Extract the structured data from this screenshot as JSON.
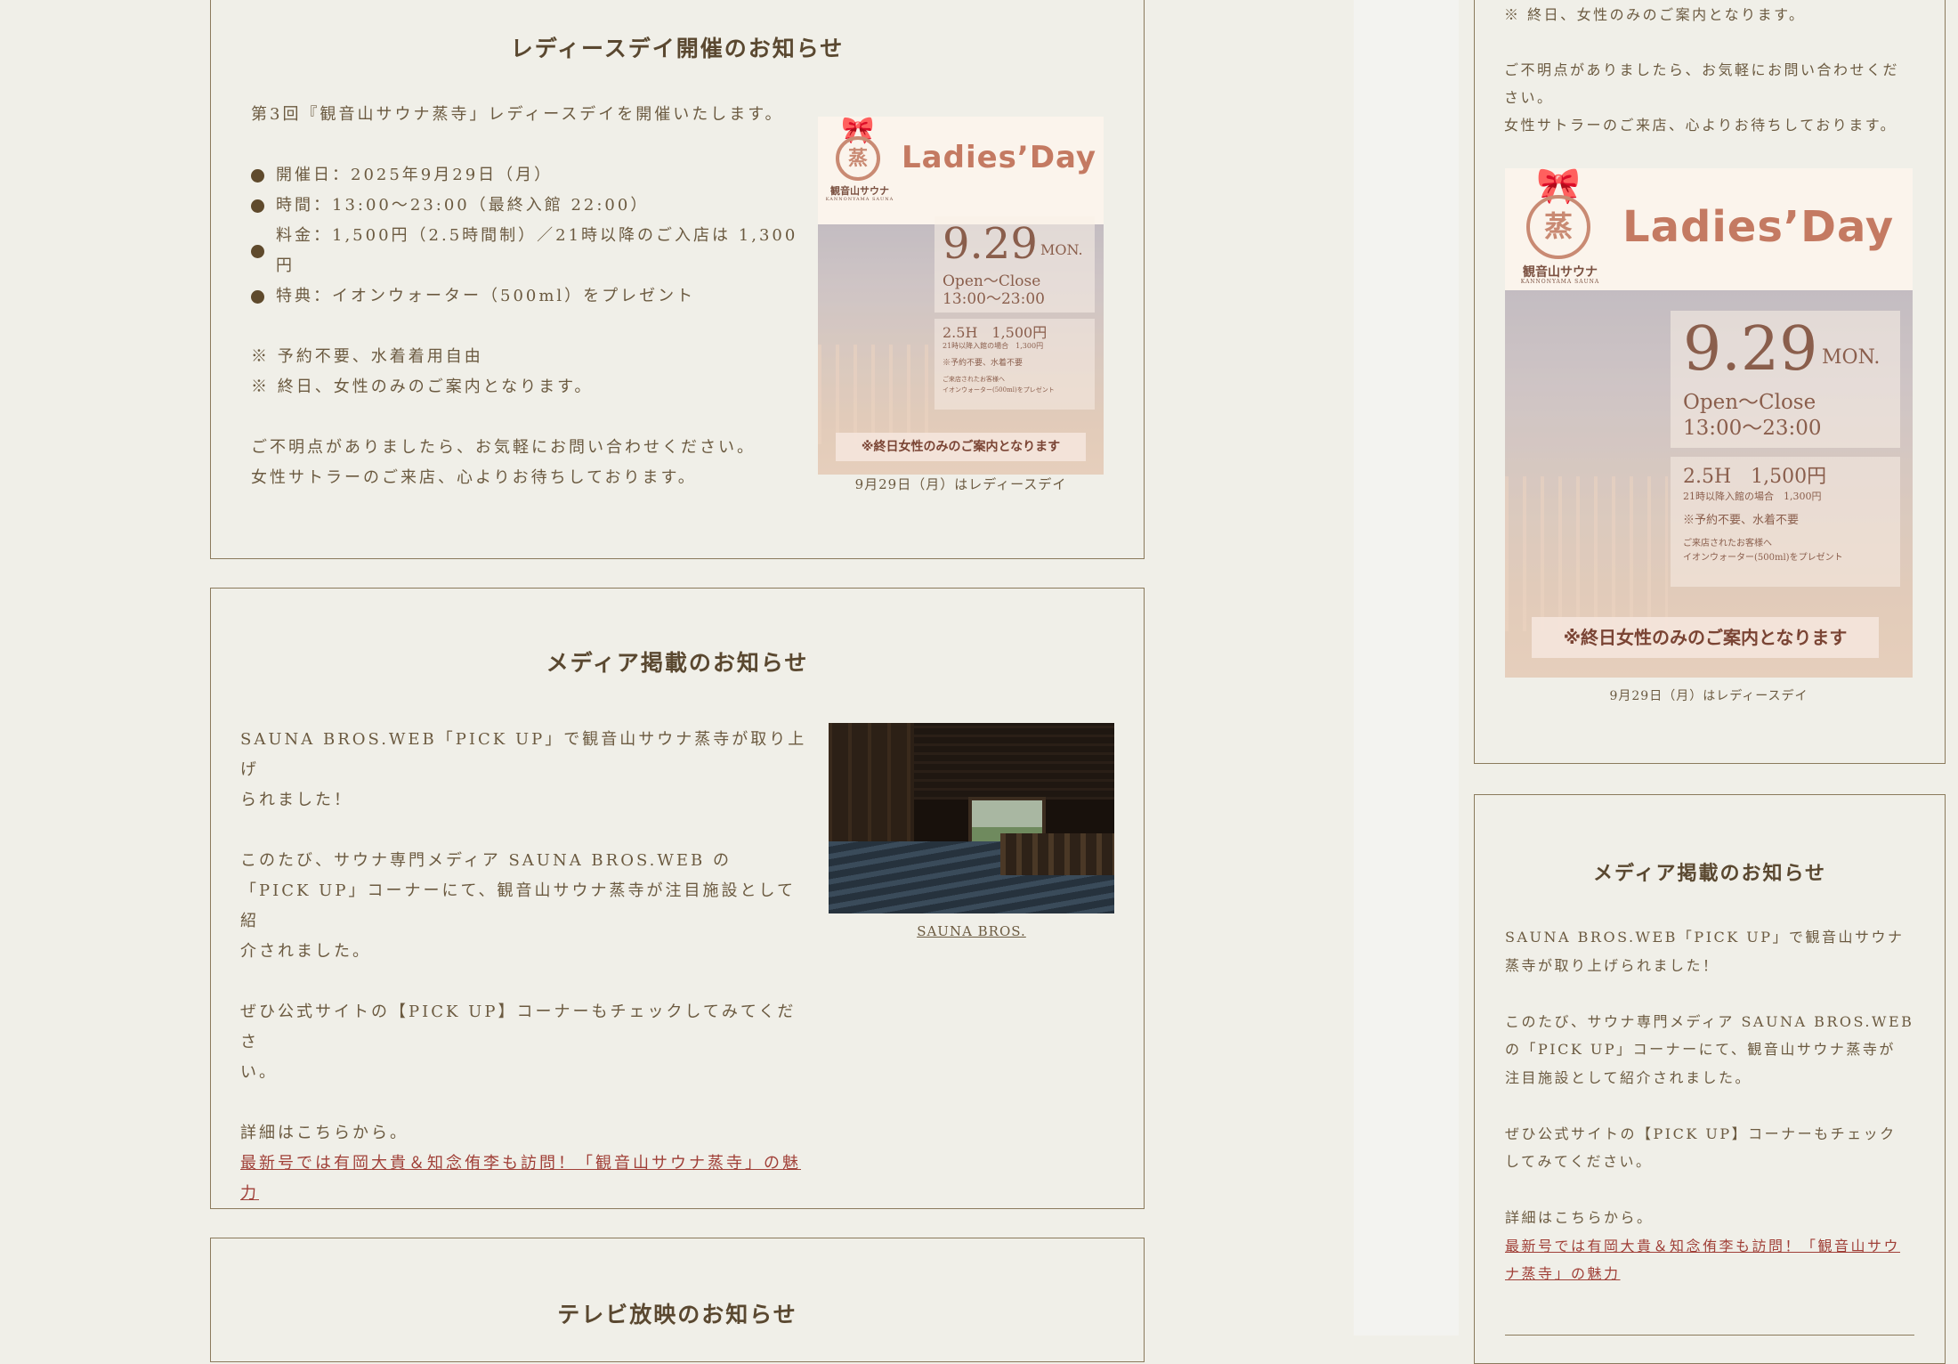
{
  "left": {
    "ladies_card": {
      "title": "レディースデイ開催のお知らせ",
      "intro": "第3回『観音山サウナ蒸寺」レディースデイを開催いたします。",
      "bullets": [
        "開催日：2025年9月29日（月）",
        "時間：13:00〜23:00（最終入館 22:00）",
        "料金：1,500円（2.5時間制）／21時以降のご入店は 1,300円",
        "特典：イオンウォーター（500ml）をプレゼント"
      ],
      "notes": [
        "※ 予約不要、水着着用自由",
        "※ 終日、女性のみのご案内となります。"
      ],
      "closing": [
        "ご不明点がありましたら、お気軽にお問い合わせください。",
        "女性サトラーのご来店、心よりお待ちしております。"
      ],
      "image_caption": "9月29日（月）はレディースデイ"
    },
    "media_card": {
      "title": "メディア掲載のお知らせ",
      "para1": [
        "SAUNA BROS.WEB「PICK UP」で観音山サウナ蒸寺が取り上げ",
        "られました！"
      ],
      "para2": [
        "このたび、サウナ専門メディア SAUNA BROS.WEB の",
        "「PICK UP」コーナーにて、観音山サウナ蒸寺が注目施設として紹",
        "介されました。"
      ],
      "para3": [
        "ぜひ公式サイトの【PICK UP】コーナーもチェックしてみてくださ",
        "い。"
      ],
      "details": "詳細はこちらから。",
      "link_lines": [
        "最新号では有岡大貴＆知念侑李も訪問！「観音山サウナ蒸寺」の魅",
        "力"
      ],
      "image_caption": "SAUNA BROS."
    },
    "tv_card": {
      "title": "テレビ放映のお知らせ"
    }
  },
  "right": {
    "top_card": {
      "partial_line": "※ 終日、女性のみのご案内となります。",
      "closing": [
        "ご不明点がありましたら、お気軽にお問い合わせくだ",
        "さい。",
        "女性サトラーのご来店、心よりお待ちしております。"
      ],
      "image_caption": "9月29日（月）はレディースデイ"
    },
    "media_card": {
      "title": "メディア掲載のお知らせ",
      "para1": [
        "SAUNA BROS.WEB「PICK UP」で観音山サウナ",
        "蒸寺が取り上げられました！"
      ],
      "para2": [
        "このたび、サウナ専門メディア SAUNA BROS.WEB",
        "の「PICK UP」コーナーにて、観音山サウナ蒸寺が",
        "注目施設として紹介されました。"
      ],
      "para3": [
        "ぜひ公式サイトの【PICK UP】コーナーもチェック",
        "してみてください。"
      ],
      "details": "詳細はこちらから。",
      "link_lines": [
        "最新号では有岡大貴＆知念侑李も訪問！「観音山サウ",
        "ナ蒸寺」の魅力"
      ]
    }
  },
  "poster": {
    "brand": "観音山サウナ",
    "brand_sub": "KANNONYAMA SAUNA",
    "heading": "Ladies’Day",
    "date": "9.29",
    "weekday": "MON.",
    "open": "Open〜Close",
    "hours": "13:00〜23:00",
    "price": "2.5H　1,500円",
    "price_note": "21時以降入館の場合　1,300円",
    "note": "※予約不要、水着不要",
    "gift1": "ご来店されたお客様へ",
    "gift2": "イオンウォーター(500ml)をプレゼント",
    "banner": "※終日女性のみのご案内となります"
  },
  "colors": {
    "background": "#f0efe8",
    "border": "#8b7a5c",
    "text": "#6b5a40",
    "heading": "#5a4830",
    "link": "#a04038",
    "bullet": "#5f4a2c",
    "poster_accent": "#c47a62"
  }
}
